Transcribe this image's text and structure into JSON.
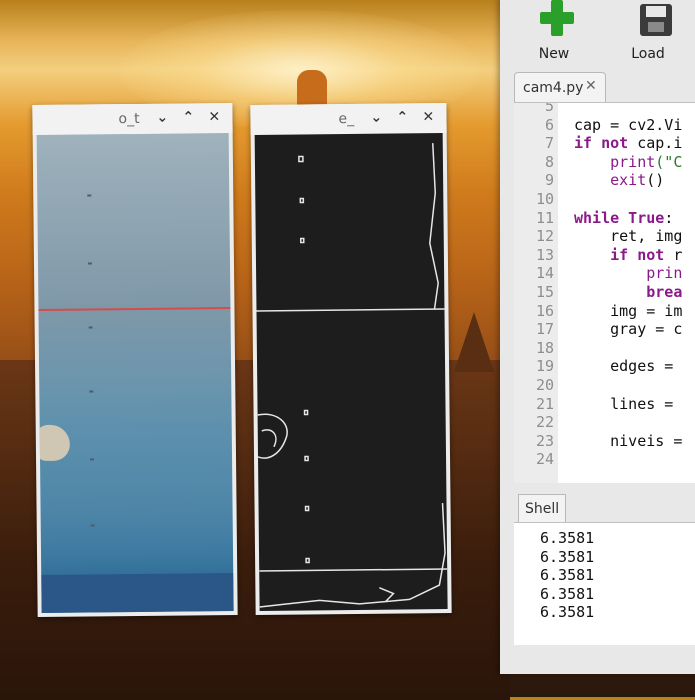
{
  "windows": {
    "original": {
      "title": "o_t",
      "controls": {
        "menu": "⌄",
        "maximize": "⌃",
        "close": "✕"
      }
    },
    "edges": {
      "title": "e_",
      "controls": {
        "menu": "⌄",
        "maximize": "⌃",
        "close": "✕"
      }
    }
  },
  "editor": {
    "toolbar": {
      "new_label": "New",
      "load_label": "Load"
    },
    "tab": {
      "filename": "cam4.py",
      "close": "✕"
    },
    "lines": [
      {
        "num": "5",
        "code": ""
      },
      {
        "num": "6",
        "code": "cap = cv2.Vi"
      },
      {
        "num": "7",
        "kw": "if not",
        "code": " cap.i"
      },
      {
        "num": "8",
        "fn": "    print",
        "str": "(\"C",
        "code": ""
      },
      {
        "num": "9",
        "fn": "    exit",
        "code": "()"
      },
      {
        "num": "10",
        "code": ""
      },
      {
        "num": "11",
        "kw": "while True",
        "code": ":"
      },
      {
        "num": "12",
        "code": "    ret, img"
      },
      {
        "num": "13",
        "kw": "    if not",
        "code": " r"
      },
      {
        "num": "14",
        "fn": "        prin",
        "code": ""
      },
      {
        "num": "15",
        "kw": "        brea",
        "code": ""
      },
      {
        "num": "16",
        "code": "    img = im"
      },
      {
        "num": "17",
        "code": "    gray = c"
      },
      {
        "num": "18",
        "code": ""
      },
      {
        "num": "19",
        "code": "    edges ="
      },
      {
        "num": "20",
        "code": ""
      },
      {
        "num": "21",
        "code": "    lines ="
      },
      {
        "num": "22",
        "code": ""
      },
      {
        "num": "23",
        "code": "    niveis ="
      },
      {
        "num": "24",
        "code": ""
      }
    ]
  },
  "shell": {
    "tab_label": "Shell",
    "output": [
      "6.3581",
      "6.3581",
      "6.3581",
      "6.3581",
      "6.3581"
    ]
  },
  "colors": {
    "accent_green": "#2aa02a",
    "keyword": "#8a1a8a",
    "string": "#2a7a2a",
    "red_line": "#d44c4c"
  }
}
